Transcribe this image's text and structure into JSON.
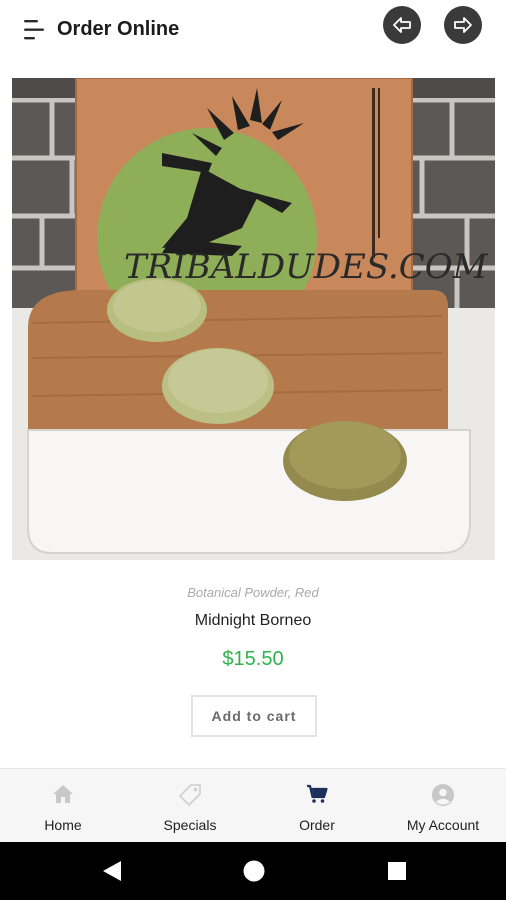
{
  "header": {
    "title": "Order Online",
    "menu_icon": "menu-lines-icon",
    "back_icon": "arrow-left-icon",
    "forward_icon": "arrow-right-icon"
  },
  "product": {
    "image_icon": "product-photo-kratom-powder",
    "image_text": "TRIBALDUDES.COM",
    "categories": "Botanical Powder, Red",
    "name": "Midnight Borneo",
    "price": "$15.50",
    "add_to_cart_label": "Add to cart"
  },
  "bottom_nav": {
    "items": [
      {
        "label": "Home",
        "icon": "home-icon",
        "active": false
      },
      {
        "label": "Specials",
        "icon": "tag-icon",
        "active": false
      },
      {
        "label": "Order",
        "icon": "cart-icon",
        "active": true
      },
      {
        "label": "My Account",
        "icon": "account-icon",
        "active": false
      }
    ]
  },
  "colors": {
    "price": "#2fb24c",
    "nav_active": "#1d2f5c",
    "nav_inactive": "#c8c8c8",
    "header_nav_circle": "#3a3a3a"
  },
  "system_bar": {
    "back_icon": "android-back-icon",
    "home_icon": "android-home-icon",
    "recents_icon": "android-recents-icon"
  }
}
